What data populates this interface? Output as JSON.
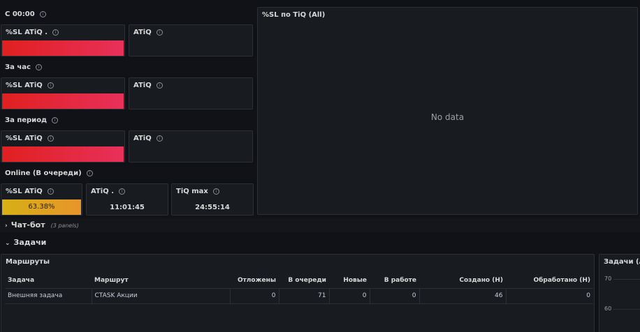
{
  "groups": {
    "since_midnight": "С 00:00",
    "per_hour": "За час",
    "per_period": "За период",
    "online": "Online (В очереди)"
  },
  "panels": {
    "sl_atiq_dot": "%SL ATiQ .",
    "sl_atiq": "%SL ATiQ",
    "atiq": "ATiQ",
    "atiq_dot": "ATiQ .",
    "tiq_max": "TiQ max"
  },
  "online": {
    "sl_atiq_value": "63.38%",
    "atiq_value": "11:01:45",
    "tiq_max_value": "24:55:14"
  },
  "sl_tiq_panel": {
    "title": "%SL по TiQ (All)",
    "empty": "No data"
  },
  "sections": {
    "chatbot": "Чат-бот",
    "chatbot_count": "(3 panels)",
    "tasks": "Задачи"
  },
  "routes": {
    "title": "Маршруты",
    "columns": [
      "Задача",
      "Маршрут",
      "Отложены",
      "В очереди",
      "Новые",
      "В работе",
      "Создано (Н)",
      "Обработано (Н)"
    ],
    "rows": [
      [
        "Внешняя задача",
        "CTASK Акции",
        "0",
        "71",
        "0",
        "0",
        "46",
        "0"
      ]
    ]
  },
  "tasks_chart": {
    "title": "Задачи (All",
    "yticks": [
      "70",
      "60"
    ]
  },
  "colors": {
    "background": "#111217",
    "panel": "#181b1f",
    "red_start": "#e02020",
    "red_end": "#e8305a",
    "yellow_start": "#d6b016",
    "yellow_end": "#e8952a"
  }
}
